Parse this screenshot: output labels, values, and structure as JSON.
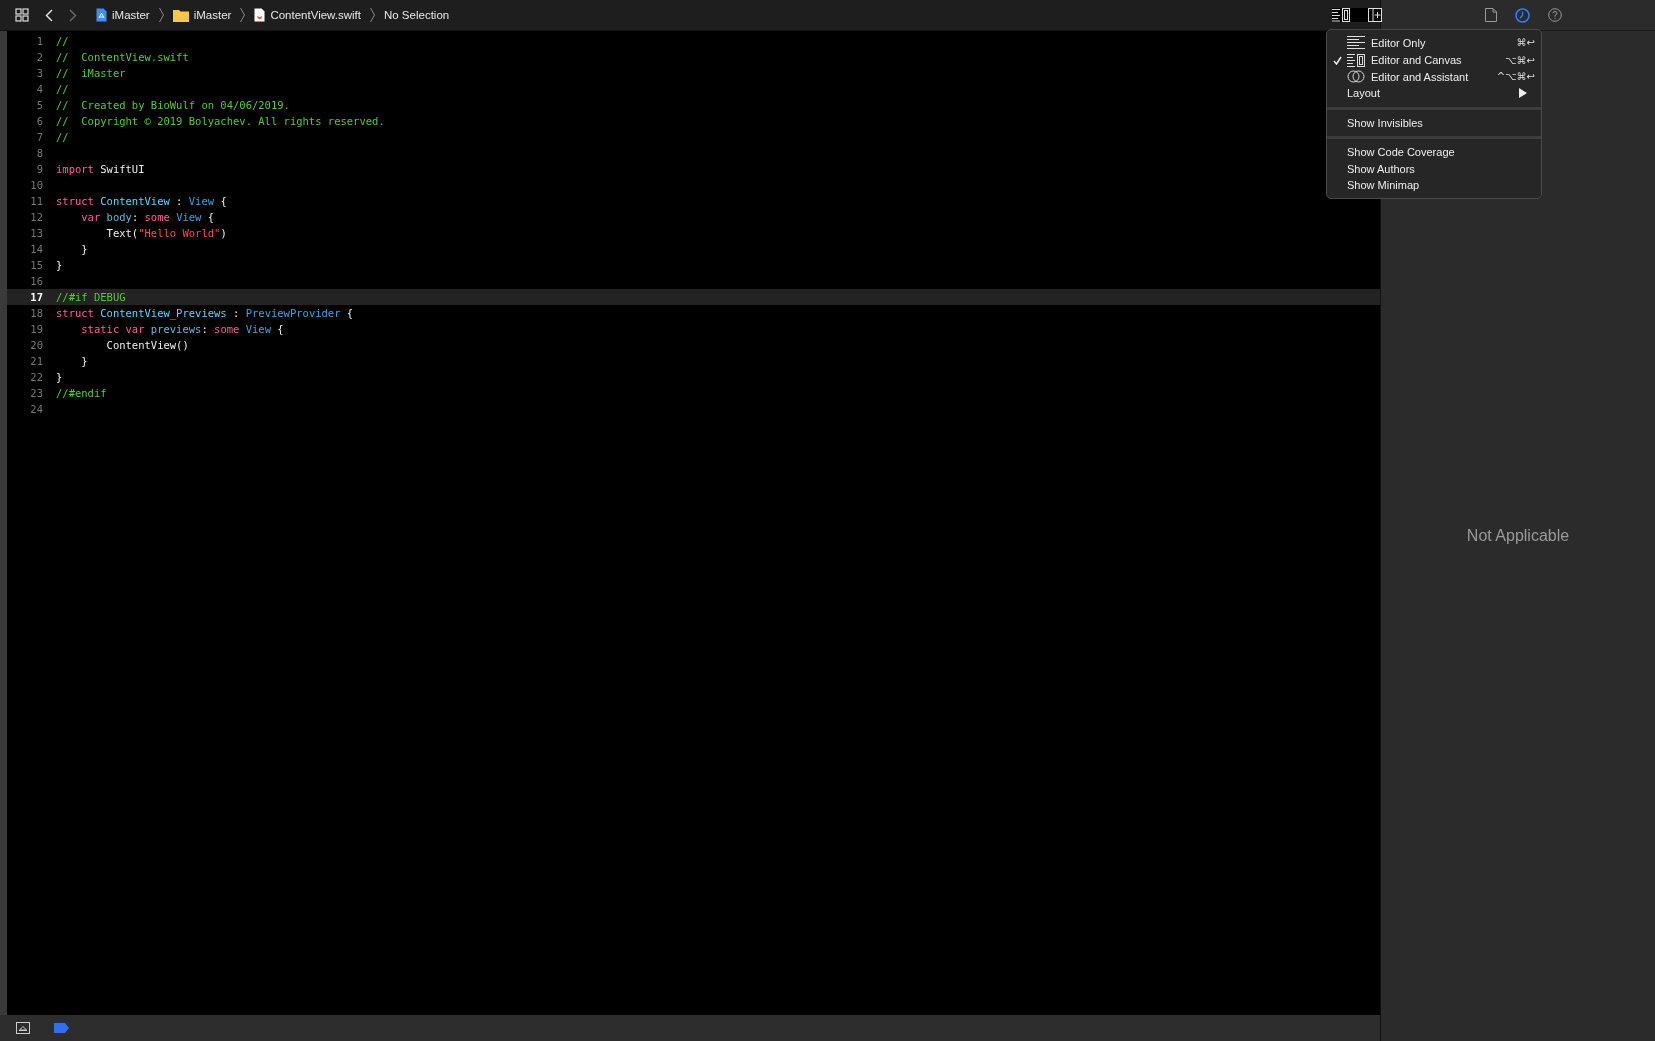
{
  "toolbar": {
    "breadcrumb": [
      {
        "kind": "project",
        "label": "iMaster"
      },
      {
        "kind": "folder",
        "label": "iMaster"
      },
      {
        "kind": "swift",
        "label": "ContentView.swift"
      },
      {
        "kind": "plain",
        "label": "No Selection"
      }
    ]
  },
  "editor": {
    "lines": [
      {
        "number": "1",
        "current": false,
        "tokens": [
          {
            "kind": "comment",
            "text": "//"
          }
        ]
      },
      {
        "number": "2",
        "current": false,
        "tokens": [
          {
            "kind": "comment",
            "text": "//  ContentView.swift"
          }
        ]
      },
      {
        "number": "3",
        "current": false,
        "tokens": [
          {
            "kind": "comment",
            "text": "//  iMaster"
          }
        ]
      },
      {
        "number": "4",
        "current": false,
        "tokens": [
          {
            "kind": "comment",
            "text": "//"
          }
        ]
      },
      {
        "number": "5",
        "current": false,
        "tokens": [
          {
            "kind": "comment",
            "text": "//  Created by BioWulf on 04/06/2019."
          }
        ]
      },
      {
        "number": "6",
        "current": false,
        "tokens": [
          {
            "kind": "comment",
            "text": "//  Copyright © 2019 Bolyachev. All rights reserved."
          }
        ]
      },
      {
        "number": "7",
        "current": false,
        "tokens": [
          {
            "kind": "comment",
            "text": "//"
          }
        ]
      },
      {
        "number": "8",
        "current": false
      },
      {
        "number": "9",
        "current": false,
        "tokens": [
          {
            "kind": "keyword",
            "text": "import"
          },
          {
            "kind": "plain",
            "text": " SwiftUI"
          }
        ]
      },
      {
        "number": "10",
        "current": false
      },
      {
        "number": "11",
        "current": false,
        "tokens": [
          {
            "kind": "keyword",
            "text": "struct"
          },
          {
            "kind": "decl",
            "text": " ContentView"
          },
          {
            "kind": "plain",
            "text": " : "
          },
          {
            "kind": "type",
            "text": "View"
          },
          {
            "kind": "plain",
            "text": " {"
          }
        ]
      },
      {
        "number": "12",
        "current": false,
        "tokens": [
          {
            "kind": "keyword",
            "text": "    var"
          },
          {
            "kind": "ident",
            "text": " body"
          },
          {
            "kind": "plain",
            "text": ": "
          },
          {
            "kind": "keyword",
            "text": "some"
          },
          {
            "kind": "type",
            "text": " View"
          },
          {
            "kind": "plain",
            "text": " {"
          }
        ]
      },
      {
        "number": "13",
        "current": false,
        "tokens": [
          {
            "kind": "plain",
            "text": "        Text("
          },
          {
            "kind": "string",
            "text": "\"Hello World\""
          },
          {
            "kind": "plain",
            "text": ")"
          }
        ]
      },
      {
        "number": "14",
        "current": false,
        "tokens": [
          {
            "kind": "plain",
            "text": "    }"
          }
        ]
      },
      {
        "number": "15",
        "current": false,
        "tokens": [
          {
            "kind": "plain",
            "text": "}"
          }
        ]
      },
      {
        "number": "16",
        "current": false
      },
      {
        "number": "17",
        "current": true,
        "tokens": [
          {
            "kind": "comment",
            "text": "//#if DEBUG"
          }
        ]
      },
      {
        "number": "18",
        "current": false,
        "tokens": [
          {
            "kind": "keyword",
            "text": "struct"
          },
          {
            "kind": "decl",
            "text": " ContentView_Previews"
          },
          {
            "kind": "plain",
            "text": " : "
          },
          {
            "kind": "type",
            "text": "PreviewProvider"
          },
          {
            "kind": "plain",
            "text": " {"
          }
        ]
      },
      {
        "number": "19",
        "current": false,
        "tokens": [
          {
            "kind": "keyword",
            "text": "    static var"
          },
          {
            "kind": "ident",
            "text": " previews"
          },
          {
            "kind": "plain",
            "text": ": "
          },
          {
            "kind": "keyword",
            "text": "some"
          },
          {
            "kind": "type",
            "text": " View"
          },
          {
            "kind": "plain",
            "text": " {"
          }
        ]
      },
      {
        "number": "20",
        "current": false,
        "tokens": [
          {
            "kind": "plain",
            "text": "        ContentView()"
          }
        ]
      },
      {
        "number": "21",
        "current": false,
        "tokens": [
          {
            "kind": "plain",
            "text": "    }"
          }
        ]
      },
      {
        "number": "22",
        "current": false,
        "tokens": [
          {
            "kind": "plain",
            "text": "}"
          }
        ]
      },
      {
        "number": "23",
        "current": false,
        "tokens": [
          {
            "kind": "comment",
            "text": "//#endif"
          }
        ]
      },
      {
        "number": "24",
        "current": false
      }
    ]
  },
  "menu": {
    "groups": [
      [
        {
          "kind": "lines",
          "label": "Editor Only",
          "shortcut": "⌘↩",
          "checked": false
        },
        {
          "kind": "canvas",
          "label": "Editor and Canvas",
          "shortcut": "⌥⌘↩",
          "checked": true
        },
        {
          "kind": "assistant",
          "label": "Editor and Assistant",
          "shortcut": "^⌥⌘↩",
          "checked": false
        },
        {
          "kind": "submenu",
          "label": "Layout",
          "checked": false
        }
      ],
      [
        {
          "kind": "plain",
          "label": "Show Invisibles",
          "checked": false
        }
      ],
      [
        {
          "kind": "plain",
          "label": "Show Code Coverage",
          "checked": false
        },
        {
          "kind": "plain",
          "label": "Show Authors",
          "checked": false
        },
        {
          "kind": "plain",
          "label": "Show Minimap",
          "checked": false
        }
      ]
    ]
  },
  "inspector": {
    "tabs": [
      {
        "kind": "file",
        "selected": false
      },
      {
        "kind": "history",
        "selected": true
      },
      {
        "kind": "help",
        "selected": false
      }
    ],
    "empty_message": "Not Applicable"
  }
}
